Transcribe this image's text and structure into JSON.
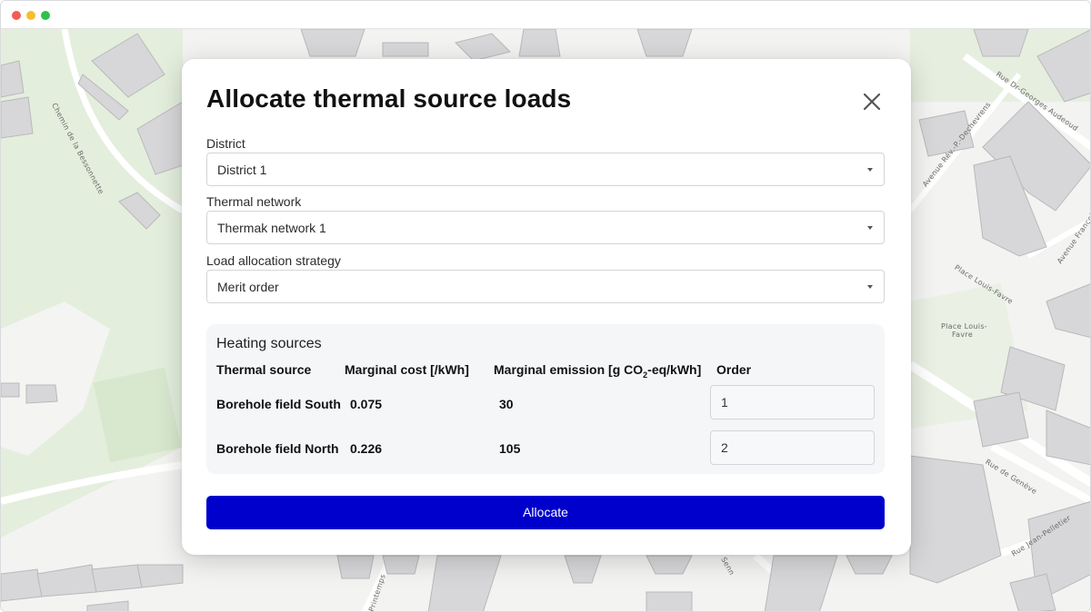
{
  "window": {
    "controls": [
      "close",
      "minimize",
      "maximize"
    ]
  },
  "map": {
    "street_labels": [
      "Chemin de la Bessonnette",
      "Rue Dr-Georges Audeoud",
      "Avenue Rév.-P.-Dechevrens",
      "Avenue François",
      "Place Louis-Favre",
      "Place Louis-",
      "Favre",
      "Rue de Genève",
      "Rue Jean-Pelletier",
      "Printemps",
      "Senn"
    ]
  },
  "modal": {
    "title": "Allocate thermal source loads",
    "close_icon": "close-icon",
    "district": {
      "label": "District",
      "value": "District 1"
    },
    "thermal_network": {
      "label": "Thermal network",
      "value": "Thermak network 1"
    },
    "strategy": {
      "label": "Load allocation strategy",
      "value": "Merit order"
    },
    "heating_sources": {
      "title": "Heating sources",
      "columns": {
        "source": "Thermal source",
        "cost": "Marginal cost [/kWh]",
        "emission_prefix": "Marginal emission [g CO",
        "emission_sub": "2",
        "emission_suffix": "-eq/kWh]",
        "order": "Order"
      },
      "rows": [
        {
          "source": "Borehole field South",
          "cost": "0.075",
          "emission": "30",
          "order": "1"
        },
        {
          "source": "Borehole field North",
          "cost": "0.226",
          "emission": "105",
          "order": "2"
        }
      ]
    },
    "allocate_label": "Allocate",
    "accent_color": "#0000cc"
  }
}
